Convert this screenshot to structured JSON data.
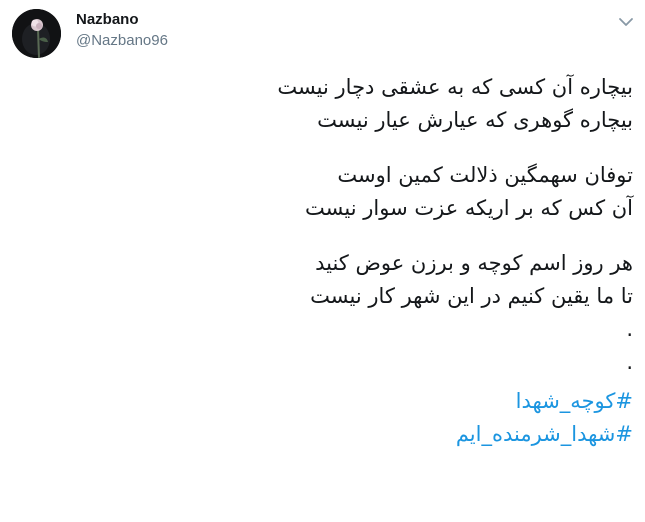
{
  "user": {
    "display_name": "Nazbano",
    "handle": "@Nazbano96",
    "avatar_icon": "avatar-rose-photo"
  },
  "menu": {
    "icon": "chevron-down-icon"
  },
  "tweet": {
    "stanza1": [
      "بیچاره آن کسی که به عشقی دچار نیست",
      "بیچاره گوهری که عیارش عیار نیست"
    ],
    "stanza2": [
      "توفان سهمگین ذلالت کمین اوست",
      "آن کس که بر اریکه عزت سوار نیست"
    ],
    "stanza3": [
      "هر روز اسم کوچه و برزن عوض کنید",
      "تا ما یقین کنیم در این شهر کار نیست"
    ],
    "dots": [
      ".",
      "."
    ],
    "hashtags": [
      "#کوچه_شهدا",
      "#شهدا_شرمنده_ایم"
    ]
  },
  "colors": {
    "text": "#14171a",
    "secondary": "#657786",
    "link": "#1b95e0"
  }
}
